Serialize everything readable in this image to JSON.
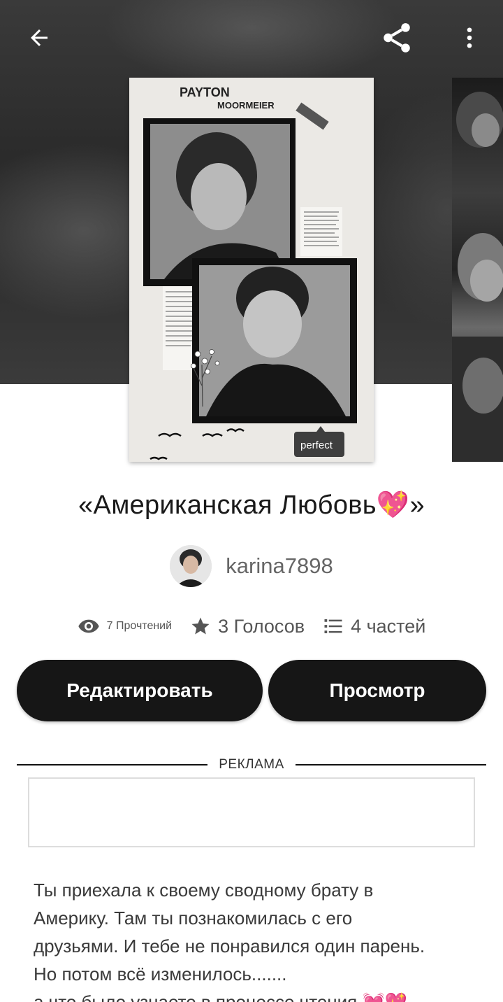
{
  "topbar": {
    "back_icon": "arrow-left-icon",
    "share_icon": "share-icon",
    "more_icon": "more-vertical-icon"
  },
  "cover": {
    "title_line1": "PAYTON",
    "title_line2": "MOORMEIER",
    "tag": "perfect"
  },
  "story": {
    "title": "«Американская Любовь💖»",
    "author": "karina7898"
  },
  "stats": {
    "reads": "7 Прочтений",
    "votes": "3 Голосов",
    "parts": "4 частей"
  },
  "actions": {
    "edit_label": "Редактировать",
    "view_label": "Просмотр"
  },
  "ad": {
    "label": "РЕКЛАМА"
  },
  "description": "Ты приехала к своему сводному брату в\nАмерику. Там ты  познакомилась с его\nдрузьями. И тебе не понравился один парень.\nНо потом всё изменилось.......\nа что было узнаете в процессе чтения 💓💖",
  "colors": {
    "button_bg": "#161616",
    "hero_bg": "#2f2f2f"
  }
}
